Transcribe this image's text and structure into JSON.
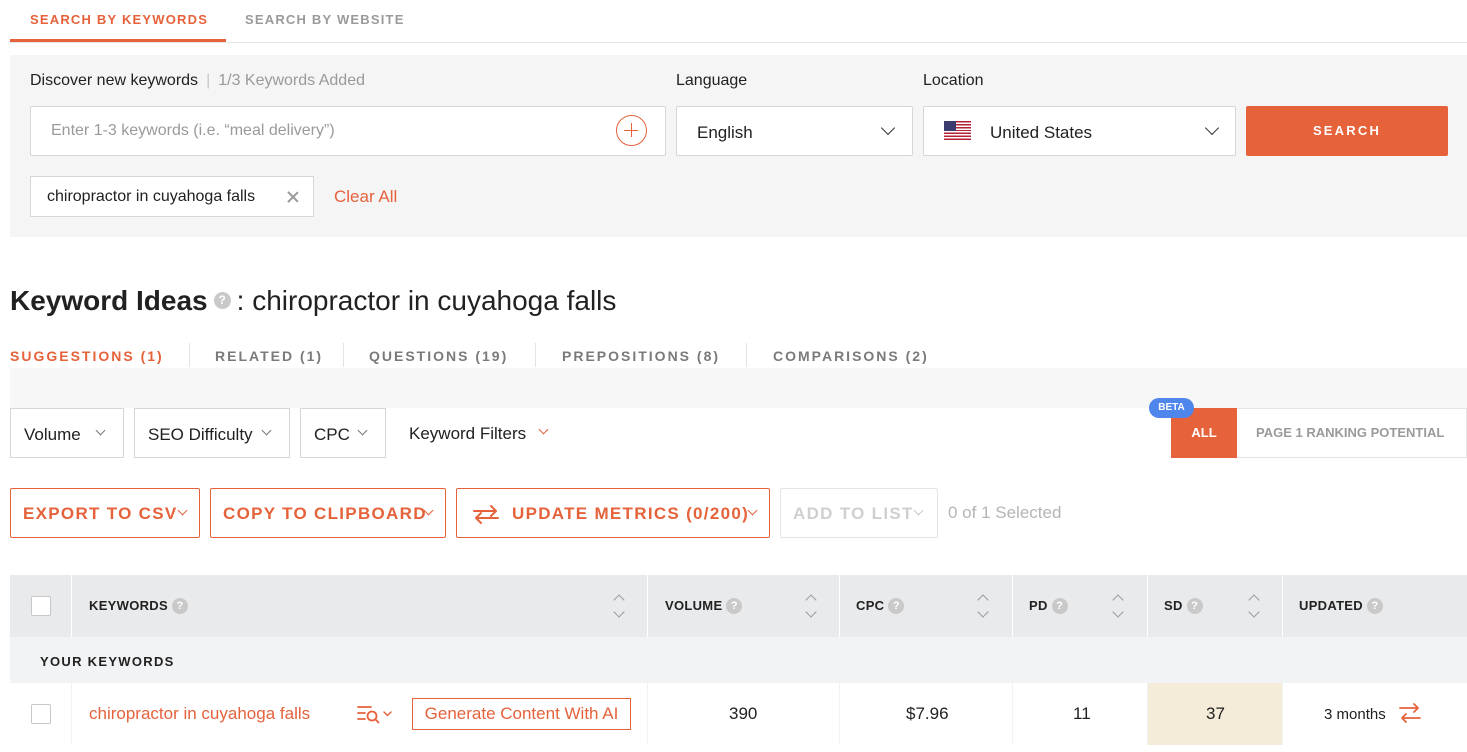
{
  "top_tabs": [
    {
      "label": "SEARCH BY KEYWORDS",
      "active": true
    },
    {
      "label": "SEARCH BY WEBSITE",
      "active": false
    }
  ],
  "search": {
    "discover_label": "Discover new keywords",
    "keywords_added": "1/3 Keywords Added",
    "placeholder": "Enter 1-3 keywords (i.e. “meal delivery”)",
    "language_label": "Language",
    "language_value": "English",
    "location_label": "Location",
    "location_value": "United States",
    "button_label": "SEARCH",
    "chips": [
      "chiropractor in cuyahoga falls"
    ],
    "clear_all": "Clear All"
  },
  "keyword_ideas": {
    "title": "Keyword Ideas",
    "query": "chiropractor in cuyahoga falls",
    "help": "?",
    "tabs": [
      {
        "label": "SUGGESTIONS (1)",
        "active": true
      },
      {
        "label": "RELATED (1)",
        "active": false
      },
      {
        "label": "QUESTIONS (19)",
        "active": false
      },
      {
        "label": "PREPOSITIONS (8)",
        "active": false
      },
      {
        "label": "COMPARISONS (2)",
        "active": false
      }
    ]
  },
  "filters": {
    "volume": "Volume",
    "seo_difficulty": "SEO Difficulty",
    "cpc": "CPC",
    "keyword_filters": "Keyword Filters",
    "beta": "BETA",
    "all": "ALL",
    "ranking_potential": "PAGE 1 RANKING POTENTIAL"
  },
  "actions": {
    "export": "EXPORT TO CSV",
    "copy": "COPY TO CLIPBOARD",
    "update": "UPDATE METRICS (0/200)",
    "add_to_list": "ADD TO LIST",
    "selected": "0 of 1 Selected"
  },
  "table": {
    "columns": [
      "KEYWORDS",
      "VOLUME",
      "CPC",
      "PD",
      "SD",
      "UPDATED"
    ],
    "group_label": "YOUR KEYWORDS",
    "rows": [
      {
        "keyword": "chiropractor in cuyahoga falls",
        "generate_label": "Generate Content With AI",
        "volume": "390",
        "cpc": "$7.96",
        "pd": "11",
        "sd": "37",
        "updated": "3 months"
      }
    ]
  },
  "colors": {
    "accent": "#e5623b",
    "beta": "#4f86ec",
    "sd_highlight": "#f4ecd8"
  }
}
